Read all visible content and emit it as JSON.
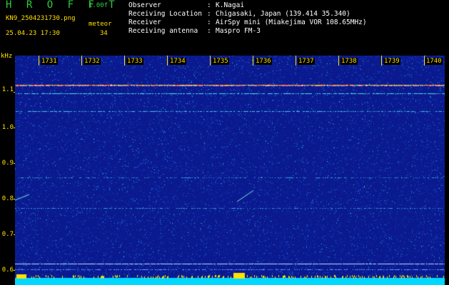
{
  "header": {
    "app_title": "H R O F F T",
    "version": "1.00f",
    "filename": "KN9_2504231730.png",
    "channel": "meteor",
    "datetime": "25.04.23 17:30",
    "count": "34"
  },
  "info": {
    "rows": [
      {
        "label": "Observer",
        "sep": ":",
        "value": "K.Nagai"
      },
      {
        "label": "Receiving Location",
        "sep": ":",
        "value": "Chigasaki, Japan (139.414 35.340)"
      },
      {
        "label": "Receiver",
        "sep": ":",
        "value": "AirSpy mini (Miakejima VOR 108.65MHz)"
      },
      {
        "label": "Receiving antenna",
        "sep": ":",
        "value": "Maspro FM-3"
      }
    ]
  },
  "axes": {
    "y_unit": "kHz",
    "y_ticks": [
      "1.1",
      "1.0",
      "0.9",
      "0.8",
      "0.7",
      "0.6"
    ],
    "x_ticks": [
      "1731",
      "1732",
      "1733",
      "1734",
      "1735",
      "1736",
      "1737",
      "1738",
      "1739",
      "1740"
    ]
  },
  "colors": {
    "background": "#000000",
    "label": "#ffe000",
    "title": "#2ecc40",
    "info_text": "#ffffff",
    "plot_base": "#0a1a8e",
    "baseline": "#00d8ff"
  }
}
